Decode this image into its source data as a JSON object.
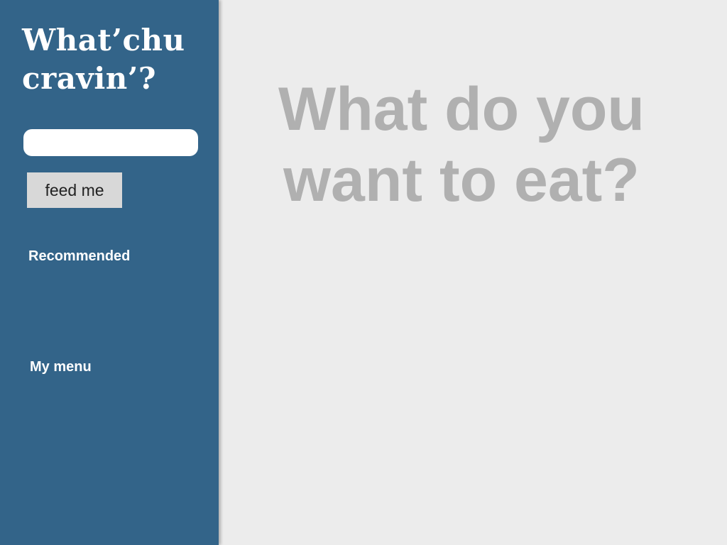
{
  "sidebar": {
    "title": "What’chu cravin’?",
    "search": {
      "value": "",
      "placeholder": ""
    },
    "feed_button_label": "feed me",
    "recommended_heading": "Recommended",
    "menu_heading": "My menu"
  },
  "main": {
    "prompt": "What do you want to eat?"
  },
  "colors": {
    "sidebar_background": "#336489",
    "main_background": "#ececec",
    "prompt_text": "#b0b0b0",
    "button_background": "#d8d8d8"
  }
}
